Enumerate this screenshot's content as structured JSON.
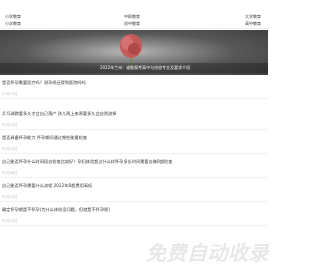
{
  "nav": {
    "items": [
      "小学教育",
      "中职教育",
      "大学教育",
      "小学教育",
      "初中教育",
      "高中教育"
    ]
  },
  "hero": {
    "caption": "2022年兰州：谁能报考高中与技校专业及要求介绍"
  },
  "articles": [
    {
      "title": "是否怀孕需要医疗吗？测孕纸还得到医院吗吗",
      "date": "07月13日"
    },
    {
      "title": "乒乓球教要多久才会自己落产 孩儿两上来原要多久会自然流掉",
      "date": "07月10日"
    },
    {
      "title": "是否具备怀孕能力 怀孕期间通过哪些能量检查",
      "date": "07月10日"
    },
    {
      "title": "自己能否怀孕什么时间段去检查比较好？孕妇体验超过什么样怀孕多长时间需要去做B超检查",
      "date": "07月08日"
    },
    {
      "title": "自己能否怀孕需要什么流程 2022年B超费用高低",
      "date": "07月10日"
    },
    {
      "title": "确定怀孕期是不怀孕(为什么体检没问题，但就是不怀孕呢)",
      "date": "07月13日"
    }
  ],
  "watermark": "免费自动收录"
}
